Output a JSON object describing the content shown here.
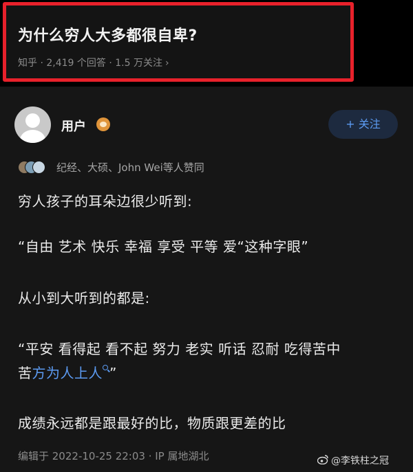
{
  "question": {
    "title": "为什么穷人大多都很自卑?",
    "meta": "知乎 · 2,419 个回答 · 1.5 万关注",
    "chevron": "›",
    "highlight_color": "#e8212b"
  },
  "author": {
    "name": "用户",
    "badge_icon": "creator-badge-icon",
    "follow_label": "+ 关注"
  },
  "voters": {
    "text": "纪经、大硕、John Wei等人赞同"
  },
  "answer": {
    "p1": "穷人孩子的耳朵边很少听到:",
    "p2": "“自由 艺术 快乐 幸福 享受 平等 爱“这种字眼”",
    "p3": "从小到大听到的都是:",
    "p4": "“平安 看得起 看不起 努力 老实 听话 忍耐 吃得苦中",
    "p5_plain": "苦",
    "p5_link": "方为人上人",
    "p5_end": "”",
    "p6": "成绩永远都是跟最好的比，物质跟更差的比"
  },
  "edit_info": "编辑于 2022-10-25 22:03 · IP 属地湖北",
  "watermark": "@李铁柱之冠",
  "colors": {
    "background": "#000000",
    "panel": "#161616",
    "link": "#5c9bf2",
    "text": "#ebebeb",
    "muted": "#8c8c8c"
  }
}
